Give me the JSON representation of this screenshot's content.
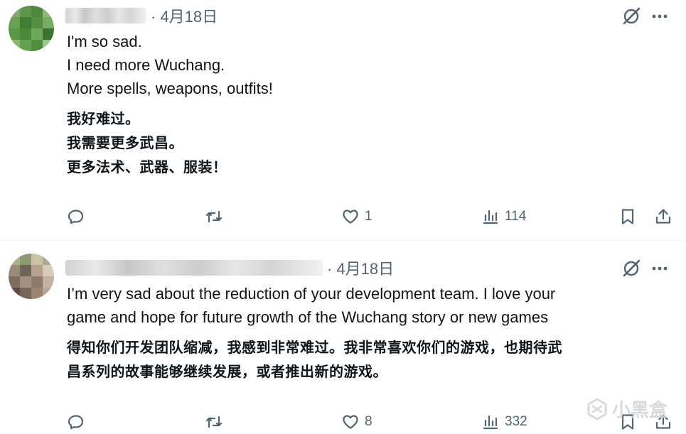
{
  "tweets": [
    {
      "date": "· 4月18日",
      "lines_en": [
        "I'm so sad.",
        "I need more Wuchang.",
        "More spells, weapons, outfits!"
      ],
      "lines_zh": [
        "我好难过。",
        "我需要更多武昌。",
        "更多法术、武器、服装！"
      ],
      "likes": "1",
      "views": "114"
    },
    {
      "date": "· 4月18日",
      "lines_en": [
        "I’m very sad about the reduction of your development team. I love your",
        "game and hope for future growth of the Wuchang story or new games"
      ],
      "lines_zh": [
        "得知你们开发团队缩减，我感到非常难过。我非常喜欢你们的游戏，也期待武",
        "昌系列的故事能够继续发展，或者推出新的游戏。"
      ],
      "likes": "8",
      "views": "332"
    }
  ],
  "watermark": "小黑盒",
  "colors": {
    "text": "#0f1419",
    "muted": "#536471",
    "divider": "#eff3f4"
  },
  "icons": [
    "reply-icon",
    "retweet-icon",
    "like-icon",
    "views-icon",
    "bookmark-icon",
    "share-icon",
    "grok-icon",
    "more-icon"
  ]
}
